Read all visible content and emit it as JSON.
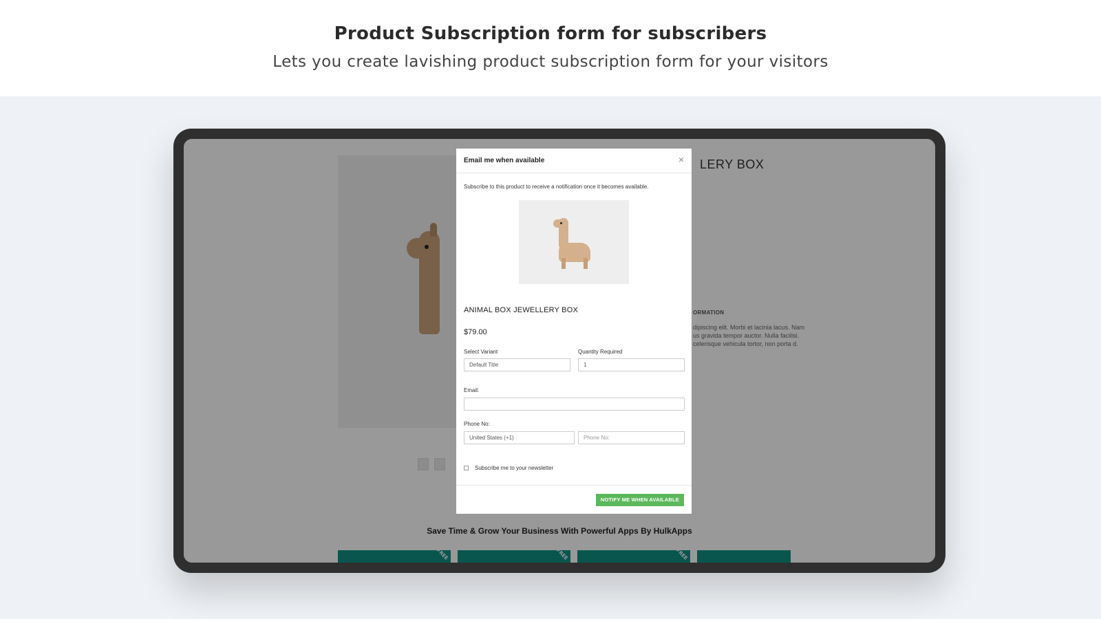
{
  "hero": {
    "title": "Product Subscription form for subscribers",
    "subtitle": "Lets you create lavishing product subscription form for your visitors"
  },
  "store": {
    "title_partial": "LERY BOX",
    "info_heading_partial": "ORMATION",
    "description_partial": "dipiscing elit. Morbi et lacinia lacus. Nam us gravida tempor auctor. Nulla facilisi. celerisque vehicula tortor, non porta d.",
    "footer_text": "Save Time & Grow Your Business With Powerful Apps By HulkApps",
    "banner_tag": "FREE"
  },
  "modal": {
    "title": "Email me when available",
    "close_glyph": "×",
    "intro": "Subscribe to this product to receive a notification once it becomes available.",
    "product_name": "ANIMAL BOX JEWELLERY BOX",
    "price": "$79.00",
    "variant_label": "Select Variant",
    "variant_value": "Default Title",
    "quantity_label": "Quantity Required",
    "quantity_value": "1",
    "email_label": "Email:",
    "email_value": "",
    "phone_label": "Phone No:",
    "country_value": "United States (+1)",
    "phone_placeholder": "Phone No:",
    "newsletter_label": "Subscribe me to your newsletter",
    "newsletter_checked": false,
    "notify_button": "NOTIFY ME WHEN AVAILABLE"
  },
  "colors": {
    "device_frame": "#2f2f2f",
    "notify_button": "#5cb85c",
    "banner_teal": "#0f8f84",
    "background": "#eef1f5"
  }
}
